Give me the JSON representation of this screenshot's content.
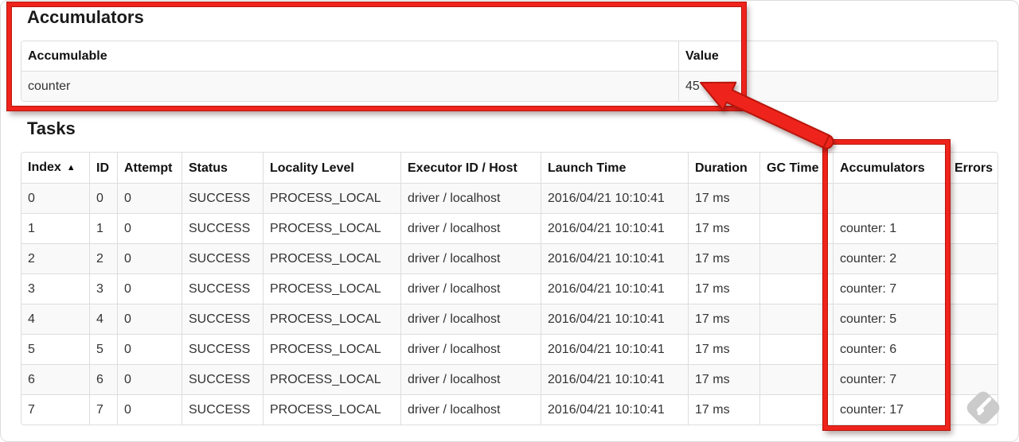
{
  "accumulators_section": {
    "title": "Accumulators",
    "table": {
      "headers": [
        "Accumulable",
        "Value"
      ],
      "rows": [
        [
          "counter",
          "45"
        ]
      ]
    }
  },
  "tasks_section": {
    "title": "Tasks",
    "table": {
      "headers": [
        {
          "label": "Index",
          "icon": "▲"
        },
        "ID",
        "Attempt",
        "Status",
        "Locality Level",
        "Executor ID / Host",
        "Launch Time",
        "Duration",
        "GC Time",
        "Accumulators",
        "Errors"
      ],
      "rows": [
        [
          "0",
          "0",
          "0",
          "SUCCESS",
          "PROCESS_LOCAL",
          "driver / localhost",
          "2016/04/21 10:10:41",
          "17 ms",
          "",
          "",
          ""
        ],
        [
          "1",
          "1",
          "0",
          "SUCCESS",
          "PROCESS_LOCAL",
          "driver / localhost",
          "2016/04/21 10:10:41",
          "17 ms",
          "",
          "counter: 1",
          ""
        ],
        [
          "2",
          "2",
          "0",
          "SUCCESS",
          "PROCESS_LOCAL",
          "driver / localhost",
          "2016/04/21 10:10:41",
          "17 ms",
          "",
          "counter: 2",
          ""
        ],
        [
          "3",
          "3",
          "0",
          "SUCCESS",
          "PROCESS_LOCAL",
          "driver / localhost",
          "2016/04/21 10:10:41",
          "17 ms",
          "",
          "counter: 7",
          ""
        ],
        [
          "4",
          "4",
          "0",
          "SUCCESS",
          "PROCESS_LOCAL",
          "driver / localhost",
          "2016/04/21 10:10:41",
          "17 ms",
          "",
          "counter: 5",
          ""
        ],
        [
          "5",
          "5",
          "0",
          "SUCCESS",
          "PROCESS_LOCAL",
          "driver / localhost",
          "2016/04/21 10:10:41",
          "17 ms",
          "",
          "counter: 6",
          ""
        ],
        [
          "6",
          "6",
          "0",
          "SUCCESS",
          "PROCESS_LOCAL",
          "driver / localhost",
          "2016/04/21 10:10:41",
          "17 ms",
          "",
          "counter: 7",
          ""
        ],
        [
          "7",
          "7",
          "0",
          "SUCCESS",
          "PROCESS_LOCAL",
          "driver / localhost",
          "2016/04/21 10:10:41",
          "17 ms",
          "",
          "counter: 17",
          ""
        ]
      ]
    }
  },
  "annotations": {
    "highlight_color": "#ee241c",
    "arrow_points_to_value": "45"
  },
  "watermark": {
    "icon": "feedly-icon",
    "color": "#cbcbcb"
  }
}
